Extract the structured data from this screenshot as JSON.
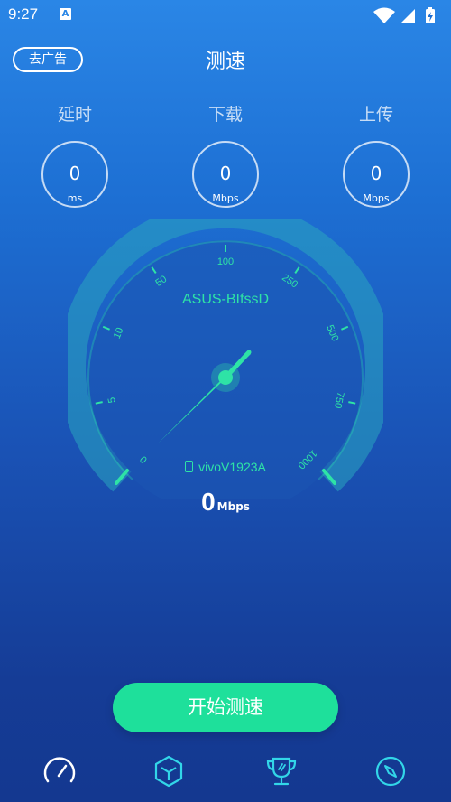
{
  "status_bar": {
    "time": "9:27",
    "notification_icon": "A",
    "icons": [
      "wifi-icon",
      "signal-icon",
      "battery-icon"
    ]
  },
  "header": {
    "remove_ads_label": "去广告",
    "title": "测速"
  },
  "metrics": [
    {
      "label": "延时",
      "value": "0",
      "unit": "ms"
    },
    {
      "label": "下载",
      "value": "0",
      "unit": "Mbps"
    },
    {
      "label": "上传",
      "value": "0",
      "unit": "Mbps"
    }
  ],
  "gauge": {
    "network_name": "ASUS-BIfssD",
    "device_name": "vivoV1923A",
    "ticks": [
      "0",
      "5",
      "10",
      "50",
      "100",
      "250",
      "500",
      "750",
      "1000"
    ],
    "needle_value_fraction": 0.0
  },
  "speed": {
    "value": "0",
    "unit": "Mbps"
  },
  "start_button_label": "开始测速",
  "nav_items": [
    "speedometer-icon",
    "cube-icon",
    "trophy-icon",
    "compass-icon"
  ],
  "colors": {
    "accent": "#1ee09b",
    "gauge_text": "#2ee3a6"
  }
}
